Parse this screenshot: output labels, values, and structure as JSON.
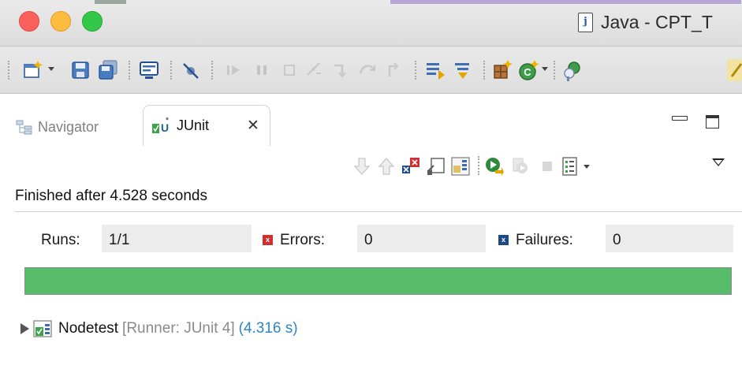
{
  "window": {
    "title": "Java - CPT_T",
    "doc_icon_glyph": "j",
    "colors": {
      "close": "#fc605c",
      "minimize": "#fdbc40",
      "zoom": "#34c84a"
    }
  },
  "toolbar": {
    "icons": [
      "new-wizard-icon",
      "save-icon",
      "save-all-icon",
      "open-console-icon",
      "skip-breakpoints-icon",
      "resume-icon",
      "suspend-icon",
      "terminate-icon",
      "disconnect-icon",
      "step-into-icon",
      "step-over-icon",
      "step-return-icon",
      "external-tools-icon",
      "use-step-filters-icon",
      "new-java-package-icon",
      "new-java-class-icon",
      "open-type-icon",
      "search-icon"
    ]
  },
  "tabs": {
    "navigator_label": "Navigator",
    "junit_label": "JUnit",
    "close_glyph": "✕"
  },
  "junit_toolbar": {
    "icons": [
      "next-failure-icon",
      "previous-failure-icon",
      "show-failures-only-icon",
      "scroll-lock-icon",
      "show-skipped-icon",
      "rerun-test-icon",
      "rerun-failed-first-icon",
      "stop-run-icon",
      "test-run-history-icon",
      "view-menu-icon"
    ]
  },
  "status": {
    "finished_text": "Finished after 4.528 seconds"
  },
  "counters": {
    "runs_label": "Runs:",
    "runs_value": "1/1",
    "errors_label": "Errors:",
    "errors_value": "0",
    "failures_label": "Failures:",
    "failures_value": "0",
    "error_glyph": "x",
    "failure_glyph": "x"
  },
  "progress": {
    "fraction": 1.0,
    "color": "#57bd6b"
  },
  "tree": {
    "items": [
      {
        "name": "Nodetest",
        "runner": "[Runner: JUnit 4]",
        "time": "(4.316 s)"
      }
    ]
  }
}
